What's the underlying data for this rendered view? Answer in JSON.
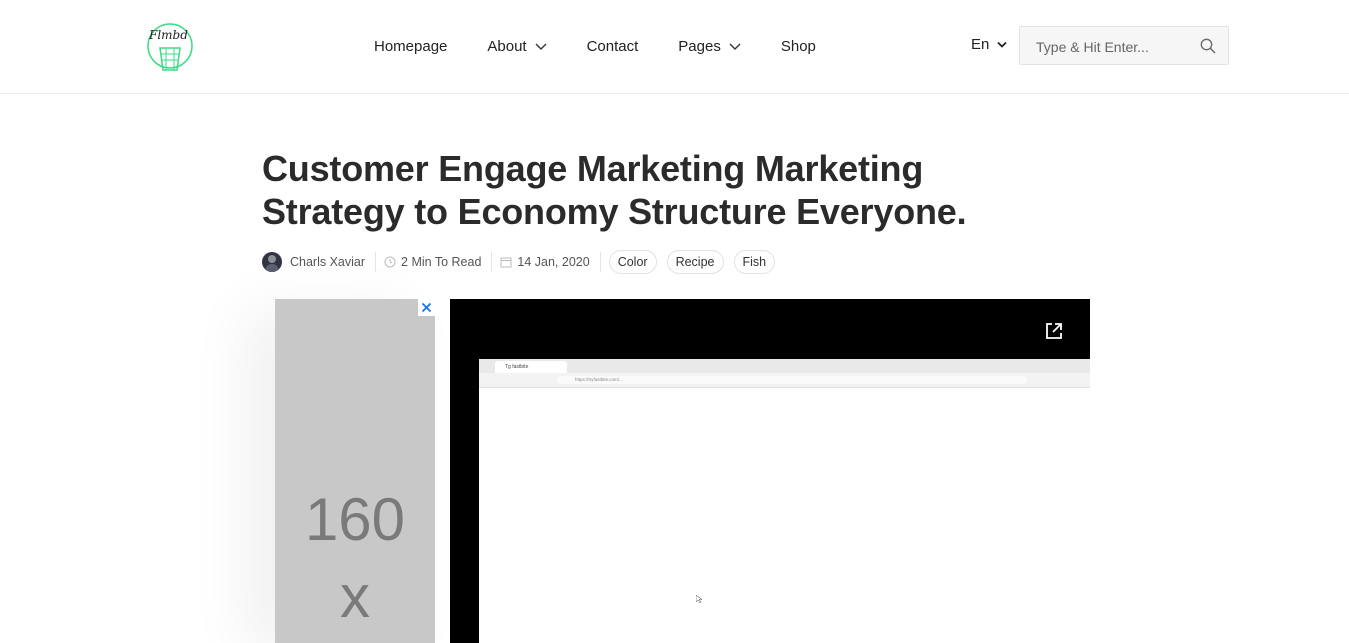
{
  "header": {
    "nav": [
      {
        "label": "Homepage",
        "has_dropdown": false
      },
      {
        "label": "About",
        "has_dropdown": true
      },
      {
        "label": "Contact",
        "has_dropdown": false
      },
      {
        "label": "Pages",
        "has_dropdown": true
      },
      {
        "label": "Shop",
        "has_dropdown": false
      }
    ],
    "language": "En",
    "search": {
      "placeholder": "Type & Hit Enter..."
    }
  },
  "article": {
    "title": "Customer Engage Marketing Marketing Strategy to Economy Structure Everyone.",
    "author": "Charls Xaviar",
    "read_time": "2 Min To Read",
    "date": "14 Jan, 2020",
    "tags": [
      "Color",
      "Recipe",
      "Fish"
    ]
  },
  "ad": {
    "line1": "160",
    "line2": "x",
    "close_symbol": "✕"
  },
  "video": {
    "embedded_tab": "Tg fastbite",
    "embedded_url": "https://tryfastbite.com/..."
  },
  "colors": {
    "logo_accent": "#3ddc84",
    "ad_close": "#1a73e8"
  }
}
